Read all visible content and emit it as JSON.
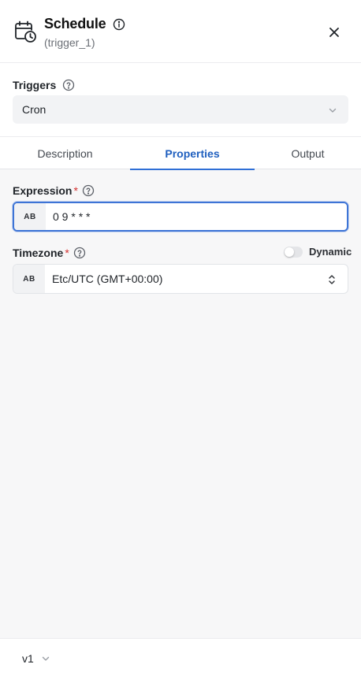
{
  "header": {
    "title": "Schedule",
    "subtitle": "(trigger_1)"
  },
  "triggers": {
    "label": "Triggers",
    "selected": "Cron"
  },
  "tabs": [
    {
      "label": "Description",
      "active": false
    },
    {
      "label": "Properties",
      "active": true
    },
    {
      "label": "Output",
      "active": false
    }
  ],
  "fields": {
    "expression": {
      "label": "Expression",
      "required_mark": "*",
      "type_badge": "AB",
      "value": "0 9 * * *"
    },
    "timezone": {
      "label": "Timezone",
      "required_mark": "*",
      "type_badge": "AB",
      "value": "Etc/UTC (GMT+00:00)",
      "dynamic_label": "Dynamic",
      "dynamic_enabled": false
    }
  },
  "footer": {
    "version": "v1"
  },
  "colors": {
    "accent": "#2f6fd6",
    "required": "#d3302f",
    "panel_bg": "#f7f7f8"
  },
  "icons": {
    "header": "calendar-clock-icon",
    "title_info": "info-icon",
    "close": "close-icon",
    "help": "help-circle-icon",
    "select_chevron": "chevron-down-icon",
    "timezone_select": "chevron-up-down-icon"
  }
}
